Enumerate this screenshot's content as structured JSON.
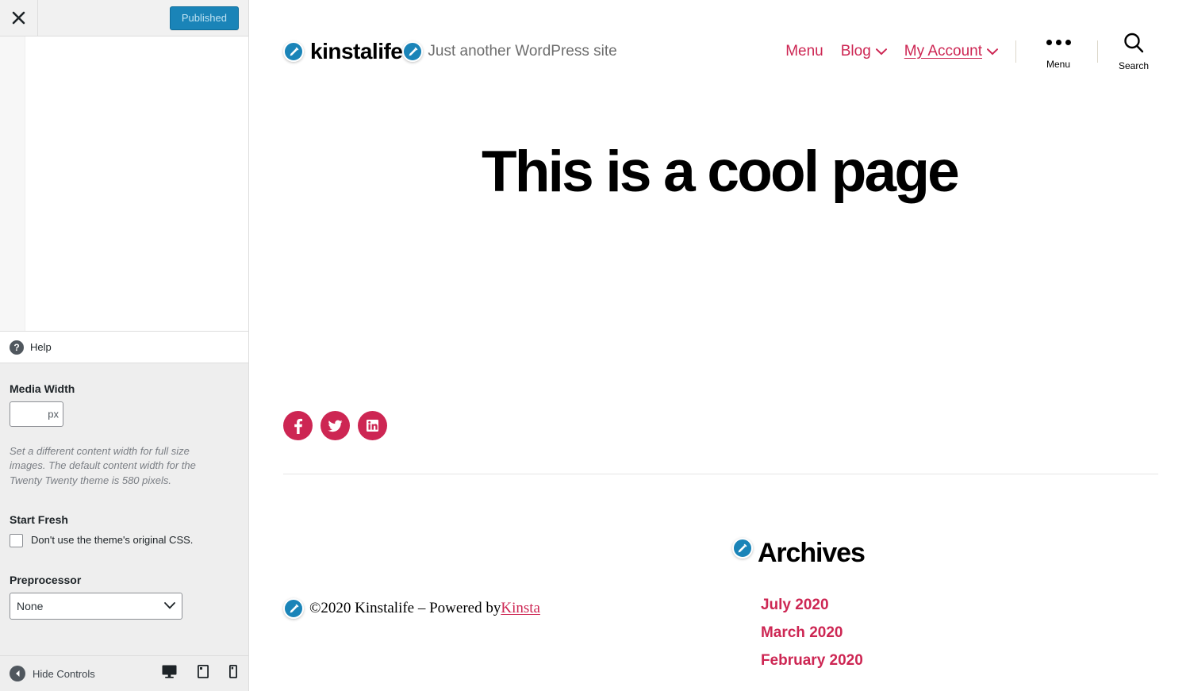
{
  "customizer": {
    "close_label": "Close",
    "publish_label": "Published",
    "css_editor_value": "",
    "help_label": "Help",
    "media_width": {
      "title": "Media Width",
      "value": "",
      "suffix": "px",
      "description": "Set a different content width for full size images. The default content width for the Twenty Twenty theme is 580 pixels."
    },
    "start_fresh": {
      "title": "Start Fresh",
      "checkbox_label": "Don't use the theme's original CSS.",
      "checked": false
    },
    "preprocessor": {
      "title": "Preprocessor",
      "selected": "None",
      "options": [
        "None"
      ]
    },
    "footer": {
      "hide_controls_label": "Hide Controls",
      "devices": [
        {
          "name": "desktop",
          "label": "Desktop",
          "active": true
        },
        {
          "name": "tablet",
          "label": "Tablet",
          "active": false
        },
        {
          "name": "mobile",
          "label": "Mobile",
          "active": false
        }
      ]
    }
  },
  "site": {
    "title": "kinstalife",
    "description": "Just another WordPress site",
    "nav": [
      {
        "label": "Menu",
        "has_chevron": false,
        "underlined": false
      },
      {
        "label": "Blog",
        "has_chevron": true,
        "underlined": false
      },
      {
        "label": "My Account",
        "has_chevron": true,
        "underlined": true
      }
    ],
    "menu_toggle_label": "Menu",
    "search_toggle_label": "Search",
    "page_title": "This is a cool page",
    "social": [
      {
        "name": "facebook",
        "label": "Facebook"
      },
      {
        "name": "twitter",
        "label": "Twitter"
      },
      {
        "name": "linkedin",
        "label": "LinkedIn"
      }
    ],
    "footer_credit": {
      "text": "©2020 Kinstalife – Powered by ",
      "link_label": "Kinsta"
    },
    "widget": {
      "title": "Archives",
      "items": [
        "July 2020",
        "March 2020",
        "February 2020"
      ]
    },
    "accent_color": "#cd2653"
  }
}
